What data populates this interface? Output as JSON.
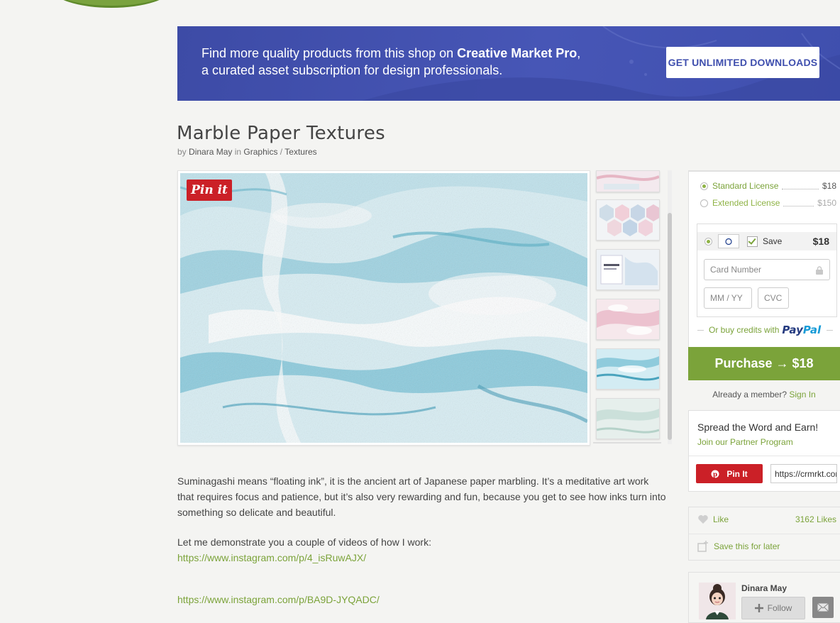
{
  "banner": {
    "line1_prefix": "Find more quality products from this shop on ",
    "line1_brand": "Creative Market Pro",
    "line1_suffix": ",",
    "line2": "a curated asset subscription for design professionals.",
    "cta": "GET UNLIMITED DOWNLOADS"
  },
  "product": {
    "title": "Marble Paper Textures",
    "by": "by",
    "author": "Dinara May",
    "in": "in",
    "category": "Graphics",
    "sep": "/",
    "subcategory": "Textures"
  },
  "gallery": {
    "pin_label": "Pin it",
    "thumb_count": 6
  },
  "description": {
    "para1": "Suminagashi means “floating ink”, it is the ancient art of Japanese paper marbling. It’s a meditative art work that requires focus and patience, but it’s also very rewarding and fun, because you get to see how inks turn into something so delicate and beautiful.",
    "para2": "Let me demonstrate you a couple of videos of how I work:",
    "link1": "https://www.instagram.com/p/4_isRuwAJX/",
    "link2": "https://www.instagram.com/p/BA9D-JYQADC/"
  },
  "licenses": [
    {
      "name": "Standard License",
      "price": "$18",
      "selected": true
    },
    {
      "name": "Extended License",
      "price": "$150",
      "selected": false
    }
  ],
  "payment": {
    "save_label": "Save",
    "save_price": "$18",
    "card_placeholder": "Card Number",
    "expiry_placeholder": "MM / YY",
    "cvc_placeholder": "CVC",
    "paypal_prefix": "Or buy credits with",
    "paypal_a": "Pay",
    "paypal_b": "Pal"
  },
  "purchase": {
    "label": "Purchase → $18"
  },
  "member": {
    "text": "Already a member?",
    "link": "Sign In"
  },
  "spread": {
    "title": "Spread the Word and Earn!",
    "link": "Join our Partner Program",
    "pin_label": "Pin It",
    "url": "https://crmrkt.com"
  },
  "social": {
    "like_label": "Like",
    "like_count": "3162 Likes",
    "save_label": "Save this for later"
  },
  "author_card": {
    "name": "Dinara May",
    "follow_label": "Follow"
  },
  "colors": {
    "accent": "#7ba33a",
    "banner": "#4150ae",
    "pinterest": "#cb2027"
  }
}
